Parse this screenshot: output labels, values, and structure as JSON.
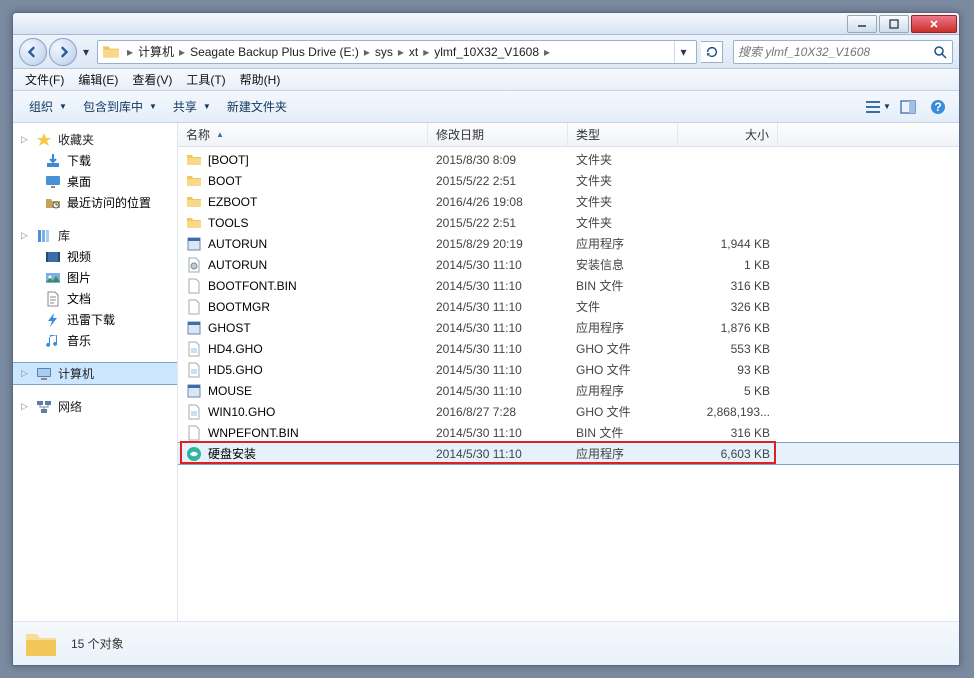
{
  "breadcrumb": [
    "计算机",
    "Seagate Backup Plus Drive (E:)",
    "sys",
    "xt",
    "ylmf_10X32_V1608"
  ],
  "search_placeholder": "搜索 ylmf_10X32_V1608",
  "menu": [
    {
      "label": "文件(F)"
    },
    {
      "label": "编辑(E)"
    },
    {
      "label": "查看(V)"
    },
    {
      "label": "工具(T)"
    },
    {
      "label": "帮助(H)"
    }
  ],
  "toolbar": {
    "organize": "组织",
    "include": "包含到库中",
    "share": "共享",
    "new_folder": "新建文件夹"
  },
  "sidebar": {
    "favorites": {
      "header": "收藏夹",
      "items": [
        "下载",
        "桌面",
        "最近访问的位置"
      ]
    },
    "libraries": {
      "header": "库",
      "items": [
        "视频",
        "图片",
        "文档",
        "迅雷下载",
        "音乐"
      ]
    },
    "computer": "计算机",
    "network": "网络"
  },
  "columns": {
    "name": "名称",
    "date": "修改日期",
    "type": "类型",
    "size": "大小"
  },
  "files": [
    {
      "name": "[BOOT]",
      "icon": "folder",
      "date": "2015/8/30 8:09",
      "type": "文件夹",
      "size": ""
    },
    {
      "name": "BOOT",
      "icon": "folder",
      "date": "2015/5/22 2:51",
      "type": "文件夹",
      "size": ""
    },
    {
      "name": "EZBOOT",
      "icon": "folder",
      "date": "2016/4/26 19:08",
      "type": "文件夹",
      "size": ""
    },
    {
      "name": "TOOLS",
      "icon": "folder",
      "date": "2015/5/22 2:51",
      "type": "文件夹",
      "size": ""
    },
    {
      "name": "AUTORUN",
      "icon": "exe",
      "date": "2015/8/29 20:19",
      "type": "应用程序",
      "size": "1,944 KB"
    },
    {
      "name": "AUTORUN",
      "icon": "ini",
      "date": "2014/5/30 11:10",
      "type": "安装信息",
      "size": "1 KB"
    },
    {
      "name": "BOOTFONT.BIN",
      "icon": "bin",
      "date": "2014/5/30 11:10",
      "type": "BIN 文件",
      "size": "316 KB"
    },
    {
      "name": "BOOTMGR",
      "icon": "bin",
      "date": "2014/5/30 11:10",
      "type": "文件",
      "size": "326 KB"
    },
    {
      "name": "GHOST",
      "icon": "exe",
      "date": "2014/5/30 11:10",
      "type": "应用程序",
      "size": "1,876 KB"
    },
    {
      "name": "HD4.GHO",
      "icon": "gho",
      "date": "2014/5/30 11:10",
      "type": "GHO 文件",
      "size": "553 KB"
    },
    {
      "name": "HD5.GHO",
      "icon": "gho",
      "date": "2014/5/30 11:10",
      "type": "GHO 文件",
      "size": "93 KB"
    },
    {
      "name": "MOUSE",
      "icon": "exe",
      "date": "2014/5/30 11:10",
      "type": "应用程序",
      "size": "5 KB"
    },
    {
      "name": "WIN10.GHO",
      "icon": "gho",
      "date": "2016/8/27 7:28",
      "type": "GHO 文件",
      "size": "2,868,193..."
    },
    {
      "name": "WNPEFONT.BIN",
      "icon": "bin",
      "date": "2014/5/30 11:10",
      "type": "BIN 文件",
      "size": "316 KB"
    },
    {
      "name": "硬盘安装",
      "icon": "installer",
      "date": "2014/5/30 11:10",
      "type": "应用程序",
      "size": "6,603 KB",
      "selected": true,
      "highlight": true
    }
  ],
  "status": {
    "count": "15 个对象"
  }
}
